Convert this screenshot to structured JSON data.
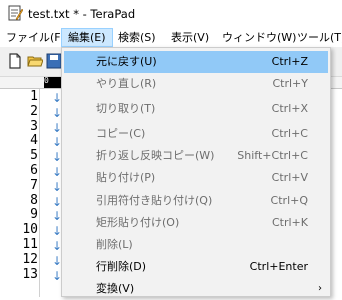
{
  "window": {
    "title": "test.txt * - TeraPad"
  },
  "menubar": {
    "items": [
      {
        "label": "ファイル(F)"
      },
      {
        "label": "編集(E)"
      },
      {
        "label": "検索(S)"
      },
      {
        "label": "表示(V)"
      },
      {
        "label": "ウィンドウ(W)"
      },
      {
        "label": "ツール(T)"
      }
    ]
  },
  "ruler": {
    "zero_label": "0"
  },
  "lines": [
    "1",
    "2",
    "3",
    "4",
    "5",
    "6",
    "7",
    "8",
    "9",
    "10",
    "11",
    "12",
    "13"
  ],
  "line_marker": "↓",
  "edit_menu": {
    "items": [
      {
        "label": "元に戻す(U)",
        "shortcut": "Ctrl+Z",
        "state": "highlighted"
      },
      {
        "label": "やり直し(R)",
        "shortcut": "Ctrl+Y",
        "state": "disabled"
      },
      {
        "label": "切り取り(T)",
        "shortcut": "Ctrl+X",
        "state": "disabled"
      },
      {
        "label": "コピー(C)",
        "shortcut": "Ctrl+C",
        "state": "disabled"
      },
      {
        "label": "折り返し反映コピー(W)",
        "shortcut": "Shift+Ctrl+C",
        "state": "disabled"
      },
      {
        "label": "貼り付け(P)",
        "shortcut": "Ctrl+V",
        "state": "disabled"
      },
      {
        "label": "引用符付き貼り付け(Q)",
        "shortcut": "Ctrl+Q",
        "state": "disabled"
      },
      {
        "label": "矩形貼り付け(O)",
        "shortcut": "Ctrl+K",
        "state": "disabled"
      },
      {
        "label": "削除(L)",
        "shortcut": "",
        "state": "disabled"
      },
      {
        "label": "行削除(D)",
        "shortcut": "Ctrl+Enter",
        "state": "enabled"
      },
      {
        "label": "変換(V)",
        "shortcut": "",
        "state": "enabled",
        "submenu_indicator": "›"
      }
    ]
  },
  "colors": {
    "highlight": "#91c9f7",
    "menu_active": "#cce8ff",
    "line_marker": "#3a7cc4",
    "disabled_text": "#6d6d6d"
  }
}
